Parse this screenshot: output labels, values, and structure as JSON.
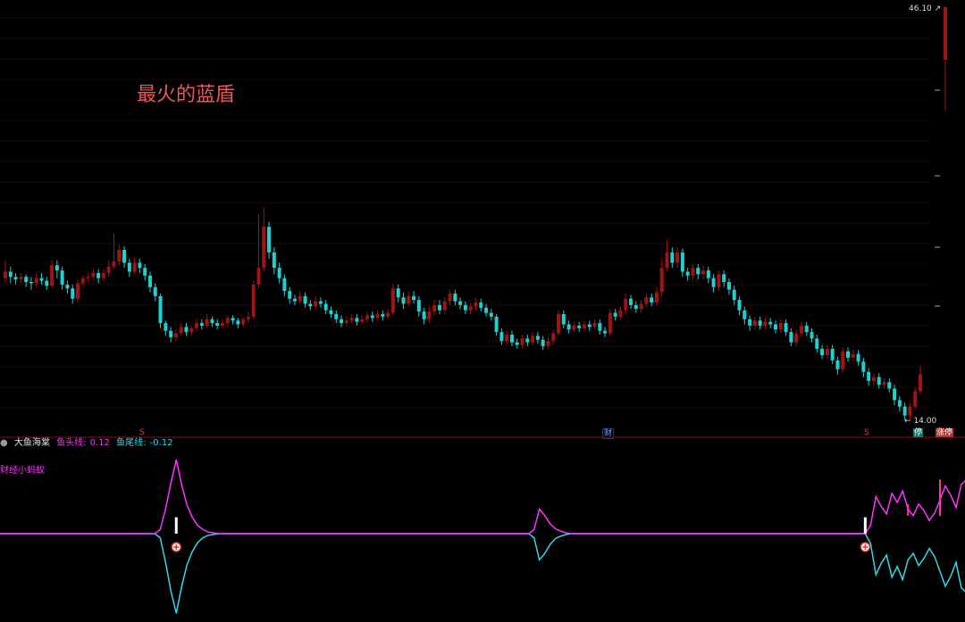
{
  "title": "最火的蓝盾",
  "price_labels": {
    "high": "46.10",
    "low": "14.00"
  },
  "markers": {
    "s1": "S",
    "cai": "财",
    "s2": "S",
    "ting": "停",
    "zhangting": "涨停"
  },
  "indicator": {
    "name": "大鱼海棠",
    "head_label": "鱼头线:",
    "head_value": "0.12",
    "tail_label": "鱼尾线:",
    "tail_value": "-0.12",
    "sub": "财经小蚂蚁"
  },
  "colors": {
    "up": "#a01414",
    "down": "#1fd0d0",
    "head": "#ff33ff",
    "tail": "#33d8e8",
    "bg": "#000000"
  },
  "chart_data": {
    "type": "candlestick",
    "ylim": [
      14.0,
      46.1
    ],
    "candles": [
      [
        25.0,
        25.5,
        26.4,
        24.6
      ],
      [
        25.5,
        25.1,
        25.9,
        24.6
      ],
      [
        25.1,
        24.9,
        25.4,
        24.5
      ],
      [
        24.9,
        25.1,
        25.4,
        24.6
      ],
      [
        25.1,
        24.7,
        25.3,
        24.3
      ],
      [
        24.7,
        24.6,
        25.1,
        24.1
      ],
      [
        24.6,
        25.0,
        25.4,
        24.3
      ],
      [
        25.0,
        24.8,
        25.4,
        24.5
      ],
      [
        24.8,
        24.4,
        25.1,
        24.1
      ],
      [
        24.4,
        26.0,
        26.4,
        24.2
      ],
      [
        26.0,
        25.6,
        26.4,
        25.0
      ],
      [
        25.6,
        24.5,
        25.9,
        24.1
      ],
      [
        24.5,
        24.2,
        24.8,
        23.8
      ],
      [
        24.2,
        23.4,
        24.5,
        23.0
      ],
      [
        23.4,
        24.6,
        24.9,
        23.1
      ],
      [
        24.6,
        25.0,
        25.2,
        24.3
      ],
      [
        25.0,
        25.1,
        25.4,
        24.7
      ],
      [
        25.1,
        25.4,
        25.7,
        24.9
      ],
      [
        25.4,
        25.0,
        25.7,
        24.6
      ],
      [
        25.0,
        25.4,
        25.7,
        24.8
      ],
      [
        25.4,
        25.9,
        26.4,
        25.1
      ],
      [
        25.9,
        26.3,
        28.5,
        25.7
      ],
      [
        26.3,
        27.2,
        27.6,
        26.0
      ],
      [
        27.2,
        26.2,
        27.5,
        25.8
      ],
      [
        26.2,
        25.5,
        26.5,
        25.1
      ],
      [
        25.5,
        26.2,
        26.6,
        25.3
      ],
      [
        26.2,
        25.8,
        26.5,
        25.4
      ],
      [
        25.8,
        25.2,
        26.1,
        24.8
      ],
      [
        25.2,
        24.3,
        25.5,
        23.9
      ],
      [
        24.3,
        23.6,
        24.6,
        23.2
      ],
      [
        23.6,
        21.5,
        23.8,
        21.1
      ],
      [
        21.5,
        20.9,
        21.7,
        20.5
      ],
      [
        20.9,
        20.4,
        21.2,
        20.0
      ],
      [
        20.4,
        20.7,
        21.0,
        20.1
      ],
      [
        20.7,
        21.2,
        21.5,
        20.5
      ],
      [
        21.2,
        20.8,
        21.5,
        20.5
      ],
      [
        20.8,
        21.1,
        21.3,
        20.6
      ],
      [
        21.1,
        21.5,
        21.8,
        20.8
      ],
      [
        21.5,
        21.3,
        21.8,
        21.0
      ],
      [
        21.3,
        21.8,
        22.2,
        21.1
      ],
      [
        21.8,
        21.5,
        22.0,
        21.2
      ],
      [
        21.5,
        21.3,
        21.8,
        21.0
      ],
      [
        21.3,
        21.5,
        21.8,
        21.1
      ],
      [
        21.5,
        21.9,
        22.1,
        21.2
      ],
      [
        21.9,
        21.7,
        22.1,
        21.4
      ],
      [
        21.7,
        21.4,
        21.9,
        21.1
      ],
      [
        21.4,
        21.8,
        22.0,
        21.2
      ],
      [
        21.8,
        22.0,
        22.4,
        21.5
      ],
      [
        22.0,
        24.5,
        24.8,
        21.8
      ],
      [
        24.5,
        25.8,
        30.0,
        24.2
      ],
      [
        25.8,
        29.0,
        30.5,
        25.5
      ],
      [
        29.0,
        27.0,
        29.4,
        26.5
      ],
      [
        27.0,
        25.8,
        27.4,
        25.3
      ],
      [
        25.8,
        25.0,
        26.2,
        24.6
      ],
      [
        25.0,
        24.0,
        25.3,
        23.6
      ],
      [
        24.0,
        23.4,
        24.3,
        23.0
      ],
      [
        23.4,
        23.2,
        23.7,
        22.9
      ],
      [
        23.2,
        23.6,
        24.0,
        23.0
      ],
      [
        23.6,
        23.0,
        23.9,
        22.7
      ],
      [
        23.0,
        22.8,
        23.3,
        22.5
      ],
      [
        22.8,
        23.2,
        23.6,
        22.5
      ],
      [
        23.2,
        23.0,
        23.5,
        22.7
      ],
      [
        23.0,
        22.5,
        23.3,
        22.2
      ],
      [
        22.5,
        22.2,
        22.8,
        21.9
      ],
      [
        22.2,
        21.8,
        22.5,
        21.5
      ],
      [
        21.8,
        21.5,
        22.1,
        21.2
      ],
      [
        21.5,
        21.7,
        22.0,
        21.3
      ],
      [
        21.7,
        21.9,
        22.2,
        21.5
      ],
      [
        21.9,
        21.6,
        22.2,
        21.3
      ],
      [
        21.6,
        21.8,
        22.1,
        21.4
      ],
      [
        21.8,
        22.1,
        22.4,
        21.5
      ],
      [
        22.1,
        21.9,
        22.4,
        21.6
      ],
      [
        21.9,
        22.2,
        22.5,
        21.7
      ],
      [
        22.2,
        22.0,
        22.5,
        21.7
      ],
      [
        22.0,
        22.3,
        22.6,
        21.8
      ],
      [
        22.3,
        24.2,
        24.6,
        22.1
      ],
      [
        24.2,
        23.5,
        24.5,
        23.1
      ],
      [
        23.5,
        23.0,
        23.9,
        22.6
      ],
      [
        23.0,
        23.6,
        24.0,
        22.8
      ],
      [
        23.6,
        23.3,
        24.0,
        23.0
      ],
      [
        23.3,
        22.4,
        23.6,
        22.0
      ],
      [
        22.4,
        21.8,
        22.7,
        21.4
      ],
      [
        21.8,
        22.4,
        22.8,
        21.5
      ],
      [
        22.4,
        22.9,
        23.3,
        22.1
      ],
      [
        22.9,
        22.5,
        23.3,
        22.2
      ],
      [
        22.5,
        23.2,
        23.5,
        22.2
      ],
      [
        23.2,
        23.8,
        24.1,
        22.9
      ],
      [
        23.8,
        23.2,
        24.1,
        22.9
      ],
      [
        23.2,
        22.9,
        23.5,
        22.6
      ],
      [
        22.9,
        22.5,
        23.2,
        22.2
      ],
      [
        22.5,
        22.8,
        23.1,
        22.2
      ],
      [
        22.8,
        23.1,
        23.5,
        22.5
      ],
      [
        23.1,
        22.7,
        23.4,
        22.4
      ],
      [
        22.7,
        22.3,
        23.0,
        22.0
      ],
      [
        22.3,
        22.0,
        22.6,
        21.7
      ],
      [
        22.0,
        20.8,
        22.2,
        20.5
      ],
      [
        20.8,
        20.1,
        21.1,
        19.8
      ],
      [
        20.1,
        20.6,
        20.9,
        19.8
      ],
      [
        20.6,
        20.0,
        20.9,
        19.7
      ],
      [
        20.0,
        19.8,
        20.3,
        19.5
      ],
      [
        19.8,
        20.3,
        20.6,
        19.5
      ],
      [
        20.3,
        20.0,
        20.6,
        19.7
      ],
      [
        20.0,
        20.5,
        20.8,
        19.8
      ],
      [
        20.5,
        20.2,
        20.8,
        19.9
      ],
      [
        20.2,
        19.7,
        20.5,
        19.4
      ],
      [
        19.7,
        20.1,
        20.4,
        19.5
      ],
      [
        20.1,
        20.7,
        21.0,
        19.8
      ],
      [
        20.7,
        22.2,
        22.5,
        20.5
      ],
      [
        22.2,
        21.4,
        22.5,
        21.1
      ],
      [
        21.4,
        21.0,
        21.7,
        20.7
      ],
      [
        21.0,
        21.3,
        21.6,
        20.8
      ],
      [
        21.3,
        21.1,
        21.6,
        20.8
      ],
      [
        21.1,
        21.4,
        21.7,
        20.8
      ],
      [
        21.4,
        21.2,
        21.7,
        20.9
      ],
      [
        21.2,
        21.5,
        21.8,
        21.0
      ],
      [
        21.5,
        20.9,
        21.8,
        20.6
      ],
      [
        20.9,
        20.7,
        21.2,
        20.4
      ],
      [
        20.7,
        22.3,
        22.6,
        20.5
      ],
      [
        22.3,
        22.0,
        22.6,
        21.7
      ],
      [
        22.0,
        22.5,
        22.8,
        21.8
      ],
      [
        22.5,
        23.4,
        23.8,
        22.2
      ],
      [
        23.4,
        22.9,
        23.7,
        22.6
      ],
      [
        22.9,
        22.6,
        23.2,
        22.3
      ],
      [
        22.6,
        23.0,
        23.3,
        22.3
      ],
      [
        23.0,
        23.5,
        23.8,
        22.7
      ],
      [
        23.5,
        23.1,
        23.8,
        22.8
      ],
      [
        23.1,
        23.9,
        24.3,
        22.9
      ],
      [
        23.9,
        25.8,
        26.5,
        23.6
      ],
      [
        25.8,
        27.0,
        28.0,
        25.5
      ],
      [
        27.0,
        26.2,
        27.4,
        25.8
      ],
      [
        26.2,
        27.0,
        27.4,
        25.8
      ],
      [
        27.0,
        25.5,
        27.3,
        25.1
      ],
      [
        25.5,
        25.2,
        25.8,
        24.8
      ],
      [
        25.2,
        25.8,
        26.1,
        24.9
      ],
      [
        25.8,
        25.3,
        26.1,
        24.9
      ],
      [
        25.3,
        25.6,
        26.0,
        24.9
      ],
      [
        25.6,
        25.0,
        25.9,
        24.6
      ],
      [
        25.0,
        24.3,
        25.3,
        23.9
      ],
      [
        24.3,
        25.3,
        25.6,
        24.0
      ],
      [
        25.3,
        24.7,
        25.6,
        24.3
      ],
      [
        24.7,
        24.1,
        25.0,
        23.7
      ],
      [
        24.1,
        23.3,
        24.4,
        22.9
      ],
      [
        23.3,
        22.5,
        23.6,
        22.1
      ],
      [
        22.5,
        21.8,
        22.8,
        21.4
      ],
      [
        21.8,
        21.3,
        22.1,
        20.9
      ],
      [
        21.3,
        21.7,
        22.0,
        21.0
      ],
      [
        21.7,
        21.3,
        22.0,
        21.0
      ],
      [
        21.3,
        21.6,
        21.9,
        21.0
      ],
      [
        21.6,
        21.4,
        21.9,
        21.1
      ],
      [
        21.4,
        21.0,
        21.7,
        20.7
      ],
      [
        21.0,
        21.5,
        21.8,
        20.7
      ],
      [
        21.5,
        20.8,
        21.8,
        20.5
      ],
      [
        20.8,
        20.0,
        21.1,
        19.7
      ],
      [
        20.0,
        20.7,
        21.0,
        19.7
      ],
      [
        20.7,
        21.3,
        21.6,
        20.4
      ],
      [
        21.3,
        20.8,
        21.6,
        20.5
      ],
      [
        20.8,
        20.3,
        21.1,
        20.0
      ],
      [
        20.3,
        19.5,
        20.6,
        19.2
      ],
      [
        19.5,
        19.0,
        19.8,
        18.7
      ],
      [
        19.0,
        19.5,
        19.8,
        18.7
      ],
      [
        19.5,
        18.6,
        19.8,
        18.3
      ],
      [
        18.6,
        17.9,
        18.9,
        17.5
      ],
      [
        17.9,
        19.3,
        19.6,
        17.6
      ],
      [
        19.3,
        18.8,
        19.6,
        18.5
      ],
      [
        18.8,
        19.1,
        19.4,
        18.5
      ],
      [
        19.1,
        18.5,
        19.4,
        18.2
      ],
      [
        18.5,
        17.7,
        18.8,
        17.3
      ],
      [
        17.7,
        17.0,
        18.0,
        16.6
      ],
      [
        17.0,
        17.3,
        17.6,
        16.6
      ],
      [
        17.3,
        16.7,
        17.6,
        16.4
      ],
      [
        16.7,
        16.9,
        17.2,
        16.4
      ],
      [
        16.9,
        16.4,
        17.2,
        16.1
      ],
      [
        16.4,
        15.5,
        16.7,
        15.1
      ],
      [
        15.5,
        15.0,
        15.8,
        14.6
      ],
      [
        15.0,
        14.3,
        15.3,
        14.0
      ],
      [
        14.3,
        15.0,
        15.3,
        14.0
      ],
      [
        15.0,
        16.2,
        16.5,
        14.8
      ],
      [
        16.2,
        17.5,
        18.2,
        16.0
      ]
    ],
    "limit_up_bar": {
      "open": 42.0,
      "close": 46.1,
      "high": 46.1,
      "low": 38.0
    },
    "indicator_series": {
      "head": [
        0,
        0,
        0,
        0,
        0,
        0,
        0,
        0,
        0,
        0,
        0,
        0,
        0,
        0,
        0,
        0,
        0,
        0,
        0,
        0,
        0,
        0,
        0,
        0,
        0,
        0,
        0,
        0,
        0,
        0,
        0.05,
        0.3,
        0.62,
        0.9,
        0.6,
        0.35,
        0.2,
        0.1,
        0.05,
        0.02,
        0.01,
        0,
        0,
        0,
        0,
        0,
        0,
        0,
        0,
        0,
        0,
        0,
        0,
        0,
        0,
        0,
        0,
        0,
        0,
        0,
        0,
        0,
        0,
        0,
        0,
        0,
        0,
        0,
        0,
        0,
        0,
        0,
        0,
        0,
        0,
        0,
        0,
        0,
        0,
        0,
        0,
        0,
        0,
        0,
        0,
        0,
        0,
        0,
        0,
        0,
        0,
        0,
        0,
        0,
        0,
        0,
        0,
        0,
        0,
        0,
        0.05,
        0.3,
        0.22,
        0.12,
        0.06,
        0.03,
        0.01,
        0,
        0,
        0,
        0,
        0,
        0,
        0,
        0,
        0,
        0,
        0,
        0,
        0,
        0,
        0,
        0,
        0,
        0,
        0,
        0,
        0,
        0,
        0,
        0,
        0,
        0,
        0,
        0,
        0,
        0,
        0,
        0,
        0,
        0,
        0,
        0,
        0,
        0,
        0,
        0,
        0,
        0,
        0,
        0,
        0,
        0,
        0,
        0,
        0,
        0,
        0,
        0,
        0,
        0,
        0,
        0,
        0.1,
        0.45,
        0.33,
        0.24,
        0.49,
        0.38,
        0.52,
        0.3,
        0.22,
        0.36,
        0.28,
        0.16,
        0.25,
        0.41,
        0.58,
        0.47,
        0.32,
        0.6,
        0.66,
        0.5,
        0.39,
        0.3,
        0.44,
        0.55,
        0.36,
        0.26,
        0.4,
        0.48,
        0.52,
        0.45,
        0.3,
        0.18,
        0.1,
        0.05,
        0.02,
        0.01,
        0
      ],
      "tail": [
        0,
        0,
        0,
        0,
        0,
        0,
        0,
        0,
        0,
        0,
        0,
        0,
        0,
        0,
        0,
        0,
        0,
        0,
        0,
        0,
        0,
        0,
        0,
        0,
        0,
        0,
        0,
        0,
        0,
        0,
        -0.05,
        -0.35,
        -0.7,
        -0.97,
        -0.65,
        -0.38,
        -0.22,
        -0.11,
        -0.05,
        -0.02,
        -0.01,
        0,
        0,
        0,
        0,
        0,
        0,
        0,
        0,
        0,
        0,
        0,
        0,
        0,
        0,
        0,
        0,
        0,
        0,
        0,
        0,
        0,
        0,
        0,
        0,
        0,
        0,
        0,
        0,
        0,
        0,
        0,
        0,
        0,
        0,
        0,
        0,
        0,
        0,
        0,
        0,
        0,
        0,
        0,
        0,
        0,
        0,
        0,
        0,
        0,
        0,
        0,
        0,
        0,
        0,
        0,
        0,
        0,
        0,
        0,
        -0.05,
        -0.32,
        -0.24,
        -0.13,
        -0.06,
        -0.03,
        -0.01,
        0,
        0,
        0,
        0,
        0,
        0,
        0,
        0,
        0,
        0,
        0,
        0,
        0,
        0,
        0,
        0,
        0,
        0,
        0,
        0,
        0,
        0,
        0,
        0,
        0,
        0,
        0,
        0,
        0,
        0,
        0,
        0,
        0,
        0,
        0,
        0,
        0,
        0,
        0,
        0,
        0,
        0,
        0,
        0,
        0,
        0,
        0,
        0,
        0,
        0,
        0,
        0,
        0,
        0,
        0,
        0,
        -0.12,
        -0.5,
        -0.36,
        -0.26,
        -0.53,
        -0.4,
        -0.56,
        -0.32,
        -0.24,
        -0.39,
        -0.3,
        -0.18,
        -0.28,
        -0.46,
        -0.64,
        -0.52,
        -0.35,
        -0.66,
        -0.72,
        -0.55,
        -0.42,
        -0.33,
        -0.48,
        -0.6,
        -0.4,
        -0.28,
        -0.44,
        -0.52,
        -0.56,
        -0.48,
        -0.32,
        -0.2,
        -0.11,
        -0.05,
        -0.02,
        -0.01,
        0
      ]
    },
    "bar_markers": [
      {
        "index": 33,
        "value": 0.2
      },
      {
        "index": 162,
        "value": 0.2
      },
      {
        "index": 186,
        "value": 0.2
      }
    ],
    "spike_markers": [
      {
        "index": 170,
        "value": 0.36
      },
      {
        "index": 176,
        "value": 0.66
      },
      {
        "index": 181,
        "value": 0.32
      }
    ]
  }
}
